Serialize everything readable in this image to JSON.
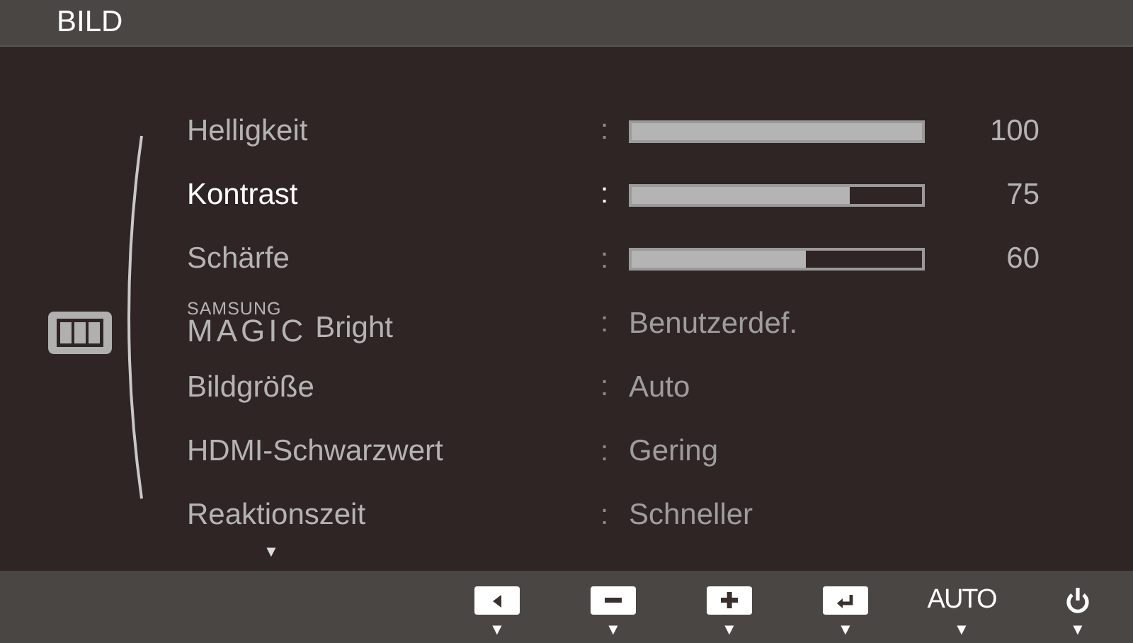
{
  "window": {
    "title": "BILD"
  },
  "menu": {
    "rows": [
      {
        "kind": "slider",
        "label": "Helligkeit",
        "separator": ":",
        "level": 1.0,
        "reading": "100",
        "selected": false
      },
      {
        "kind": "slider",
        "label": "Kontrast",
        "separator": ":",
        "level": 0.75,
        "reading": "75",
        "selected": true
      },
      {
        "kind": "slider",
        "label": "Schärfe",
        "separator": ":",
        "level": 0.6,
        "reading": "60",
        "selected": false
      },
      {
        "kind": "value",
        "brand_top": "SAMSUNG",
        "brand": "MAGIC",
        "label": "Bright",
        "separator": ":",
        "value": "Benutzerdef.",
        "selected": false
      },
      {
        "kind": "value",
        "label": "Bildgröße",
        "separator": ":",
        "value": "Auto",
        "selected": false
      },
      {
        "kind": "value",
        "label": "HDMI-Schwarzwert",
        "separator": ":",
        "value": "Gering",
        "selected": false
      },
      {
        "kind": "value",
        "label": "Reaktionszeit",
        "separator": ":",
        "value": "Schneller",
        "selected": false
      }
    ],
    "more_below": "▼"
  },
  "buttons": [
    {
      "kind": "left",
      "pointer": "▼"
    },
    {
      "kind": "minus",
      "pointer": "▼"
    },
    {
      "kind": "plus",
      "pointer": "▼"
    },
    {
      "kind": "enter",
      "pointer": "▼"
    },
    {
      "kind": "text",
      "label": "AUTO",
      "pointer": "▼"
    },
    {
      "kind": "power",
      "pointer": "▼"
    }
  ]
}
